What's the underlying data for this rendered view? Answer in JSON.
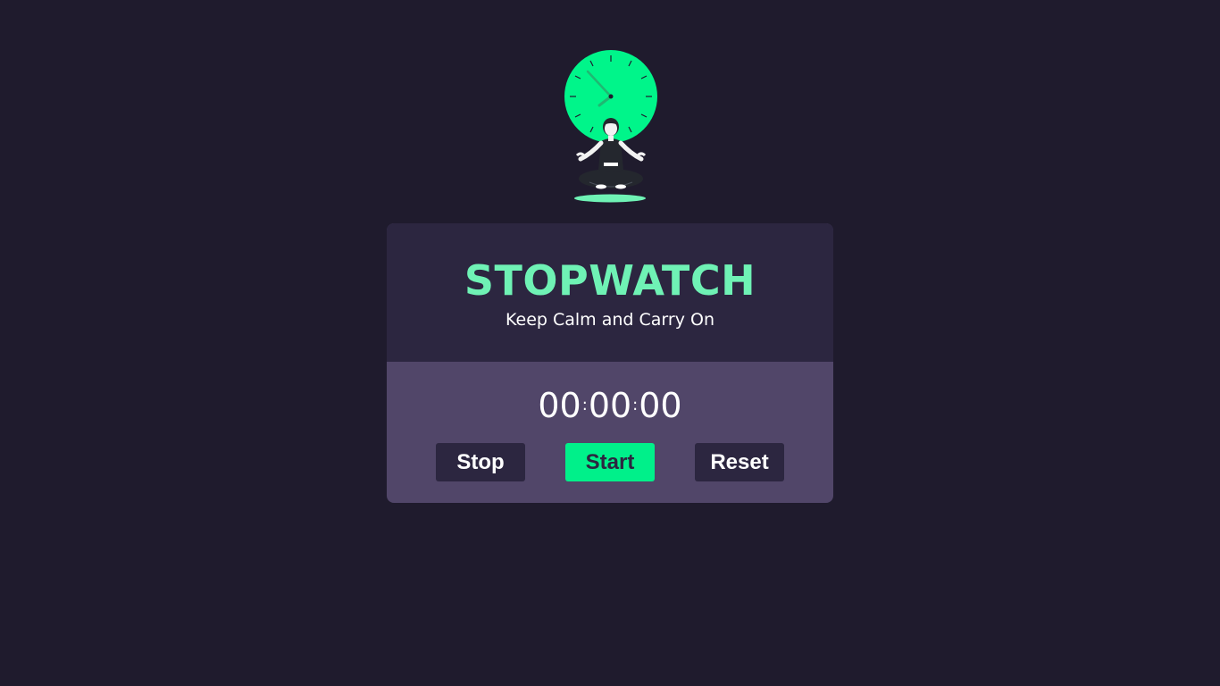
{
  "app": {
    "title": "STOPWATCH",
    "subtitle": "Keep Calm and Carry On"
  },
  "timer": {
    "hours": "00",
    "minutes": "00",
    "seconds": "00",
    "separator": ":"
  },
  "controls": {
    "stop_label": "Stop",
    "start_label": "Start",
    "reset_label": "Reset"
  },
  "illustration": {
    "icon": "meditating-woman-with-clock-icon"
  },
  "colors": {
    "background": "#1f1b2d",
    "card_header": "#2c2640",
    "card_body": "#514669",
    "accent": "#00f08a",
    "title": "#6ff2b5"
  }
}
